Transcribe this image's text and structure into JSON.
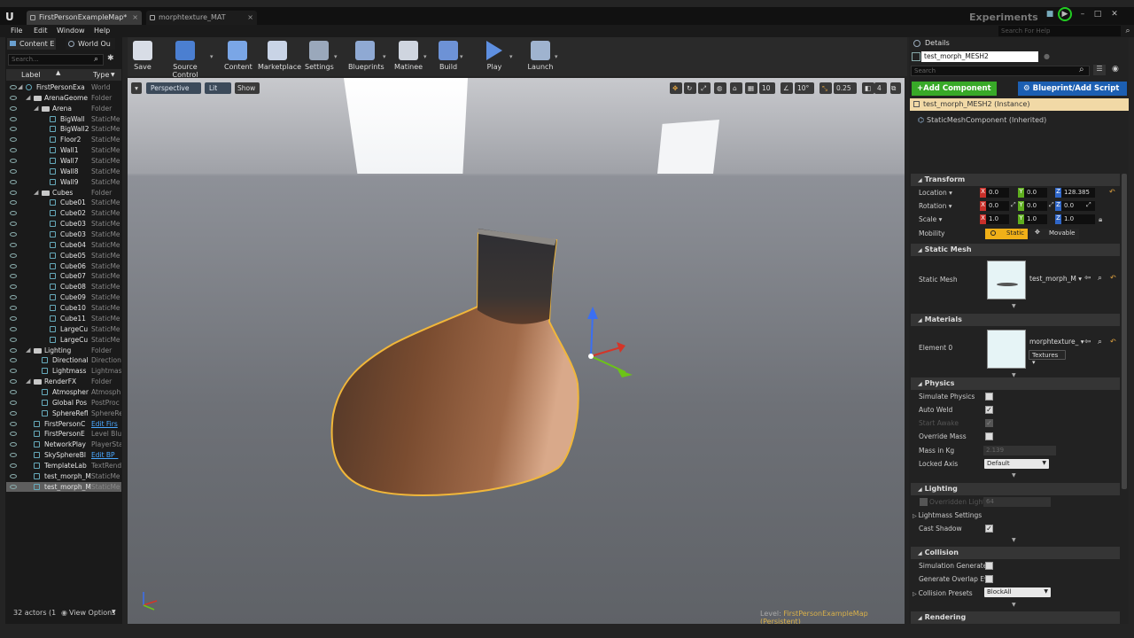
{
  "window": {
    "logo": "U",
    "tabs": [
      "FirstPersonExampleMap*",
      "morphtexture_MAT"
    ],
    "experiments": "Experiments",
    "help_search_placeholder": "Search For Help"
  },
  "menu": [
    "File",
    "Edit",
    "Window",
    "Help"
  ],
  "left_panel": {
    "tabs": [
      "Content E",
      "World Ou"
    ],
    "search_placeholder": "Search...",
    "col_label": "Label",
    "col_type": "Type",
    "rows": [
      {
        "label": "FirstPersonExa",
        "type": "World",
        "indent": 0,
        "kind": "world",
        "link": false,
        "selected": false
      },
      {
        "label": "ArenaGeome",
        "type": "Folder",
        "indent": 1,
        "kind": "folder",
        "link": false,
        "selected": false
      },
      {
        "label": "Arena",
        "type": "Folder",
        "indent": 2,
        "kind": "folder",
        "link": false,
        "selected": false
      },
      {
        "label": "BigWall",
        "type": "StaticMe",
        "indent": 3,
        "kind": "actor",
        "link": false,
        "selected": false
      },
      {
        "label": "BigWall2",
        "type": "StaticMe",
        "indent": 3,
        "kind": "actor",
        "link": false,
        "selected": false
      },
      {
        "label": "Floor2",
        "type": "StaticMe",
        "indent": 3,
        "kind": "actor",
        "link": false,
        "selected": false
      },
      {
        "label": "Wall1",
        "type": "StaticMe",
        "indent": 3,
        "kind": "actor",
        "link": false,
        "selected": false
      },
      {
        "label": "Wall7",
        "type": "StaticMe",
        "indent": 3,
        "kind": "actor",
        "link": false,
        "selected": false
      },
      {
        "label": "Wall8",
        "type": "StaticMe",
        "indent": 3,
        "kind": "actor",
        "link": false,
        "selected": false
      },
      {
        "label": "Wall9",
        "type": "StaticMe",
        "indent": 3,
        "kind": "actor",
        "link": false,
        "selected": false
      },
      {
        "label": "Cubes",
        "type": "Folder",
        "indent": 2,
        "kind": "folder",
        "link": false,
        "selected": false
      },
      {
        "label": "Cube01",
        "type": "StaticMe",
        "indent": 3,
        "kind": "actor",
        "link": false,
        "selected": false
      },
      {
        "label": "Cube02",
        "type": "StaticMe",
        "indent": 3,
        "kind": "actor",
        "link": false,
        "selected": false
      },
      {
        "label": "Cube03",
        "type": "StaticMe",
        "indent": 3,
        "kind": "actor",
        "link": false,
        "selected": false
      },
      {
        "label": "Cube03",
        "type": "StaticMe",
        "indent": 3,
        "kind": "actor",
        "link": false,
        "selected": false
      },
      {
        "label": "Cube04",
        "type": "StaticMe",
        "indent": 3,
        "kind": "actor",
        "link": false,
        "selected": false
      },
      {
        "label": "Cube05",
        "type": "StaticMe",
        "indent": 3,
        "kind": "actor",
        "link": false,
        "selected": false
      },
      {
        "label": "Cube06",
        "type": "StaticMe",
        "indent": 3,
        "kind": "actor",
        "link": false,
        "selected": false
      },
      {
        "label": "Cube07",
        "type": "StaticMe",
        "indent": 3,
        "kind": "actor",
        "link": false,
        "selected": false
      },
      {
        "label": "Cube08",
        "type": "StaticMe",
        "indent": 3,
        "kind": "actor",
        "link": false,
        "selected": false
      },
      {
        "label": "Cube09",
        "type": "StaticMe",
        "indent": 3,
        "kind": "actor",
        "link": false,
        "selected": false
      },
      {
        "label": "Cube10",
        "type": "StaticMe",
        "indent": 3,
        "kind": "actor",
        "link": false,
        "selected": false
      },
      {
        "label": "Cube11",
        "type": "StaticMe",
        "indent": 3,
        "kind": "actor",
        "link": false,
        "selected": false
      },
      {
        "label": "LargeCu",
        "type": "StaticMe",
        "indent": 3,
        "kind": "actor",
        "link": false,
        "selected": false
      },
      {
        "label": "LargeCu",
        "type": "StaticMe",
        "indent": 3,
        "kind": "actor",
        "link": false,
        "selected": false
      },
      {
        "label": "Lighting",
        "type": "Folder",
        "indent": 1,
        "kind": "folder",
        "link": false,
        "selected": false
      },
      {
        "label": "Directional",
        "type": "Direction",
        "indent": 2,
        "kind": "actor",
        "link": false,
        "selected": false
      },
      {
        "label": "Lightmass",
        "type": "Lightmas",
        "indent": 2,
        "kind": "actor",
        "link": false,
        "selected": false
      },
      {
        "label": "RenderFX",
        "type": "Folder",
        "indent": 1,
        "kind": "folder",
        "link": false,
        "selected": false
      },
      {
        "label": "Atmospher",
        "type": "Atmosph",
        "indent": 2,
        "kind": "actor",
        "link": false,
        "selected": false
      },
      {
        "label": "Global Pos",
        "type": "PostProc",
        "indent": 2,
        "kind": "actor",
        "link": false,
        "selected": false
      },
      {
        "label": "SphereRefl",
        "type": "SphereRe",
        "indent": 2,
        "kind": "actor",
        "link": false,
        "selected": false
      },
      {
        "label": "FirstPersonC",
        "type": "Edit Firs",
        "indent": 1,
        "kind": "actor",
        "link": true,
        "selected": false
      },
      {
        "label": "FirstPersonE",
        "type": "Level Blu",
        "indent": 1,
        "kind": "actor",
        "link": false,
        "selected": false
      },
      {
        "label": "NetworkPlay",
        "type": "PlayerSta",
        "indent": 1,
        "kind": "actor",
        "link": false,
        "selected": false
      },
      {
        "label": "SkySphereBl",
        "type": "Edit BP_",
        "indent": 1,
        "kind": "actor",
        "link": true,
        "selected": false
      },
      {
        "label": "TemplateLab",
        "type": "TextRend",
        "indent": 1,
        "kind": "actor",
        "link": false,
        "selected": false
      },
      {
        "label": "test_morph_M",
        "type": "StaticMe",
        "indent": 1,
        "kind": "actor",
        "link": false,
        "selected": false
      },
      {
        "label": "test_morph_M",
        "type": "StaticMe",
        "indent": 1,
        "kind": "actor",
        "link": false,
        "selected": true
      }
    ],
    "actor_count": "32 actors (1",
    "view_options": "View Options"
  },
  "toolbar": [
    {
      "label": "Save",
      "icon": "save-icon",
      "color": "#d8dde6",
      "drop": false
    },
    {
      "label": "Source Control",
      "icon": "source-control-icon",
      "color": "#4b7fd1",
      "drop": true
    },
    {
      "label": "Content",
      "icon": "content-icon",
      "color": "#7aa6e6",
      "drop": false
    },
    {
      "label": "Marketplace",
      "icon": "marketplace-icon",
      "color": "#c9d4e6",
      "drop": false
    },
    {
      "label": "Settings",
      "icon": "settings-icon",
      "color": "#9aa8bb",
      "drop": true
    },
    {
      "label": "Blueprints",
      "icon": "blueprints-icon",
      "color": "#8fa9d3",
      "drop": true
    },
    {
      "label": "Matinee",
      "icon": "matinee-icon",
      "color": "#cfd5df",
      "drop": true
    },
    {
      "label": "Build",
      "icon": "build-icon",
      "color": "#6d92d6",
      "drop": true
    },
    {
      "label": "Play",
      "icon": "play-icon",
      "color": "#5e8fe0",
      "drop": true
    },
    {
      "label": "Launch",
      "icon": "launch-icon",
      "color": "#9fb3cf",
      "drop": true
    }
  ],
  "viewport": {
    "perspective": "Perspective",
    "lit": "Lit",
    "show": "Show",
    "grid_snap": "10",
    "rot_snap": "10°",
    "scale_snap": "0.25",
    "cam_speed": "4",
    "level_label": "Level:",
    "level_name": "FirstPersonExampleMap (Persistent)"
  },
  "details": {
    "tab": "Details",
    "name": "test_morph_MESH2",
    "search_placeholder": "Search",
    "add_component": "+Add Component",
    "blueprint": "Blueprint/Add Script",
    "instance": "test_morph_MESH2 (Instance)",
    "component": "StaticMeshComponent (Inherited)",
    "transform": {
      "header": "Transform",
      "location_label": "Location",
      "rotation_label": "Rotation",
      "scale_label": "Scale",
      "mobility_label": "Mobility",
      "location": [
        "0.0",
        "0.0",
        "128.385"
      ],
      "rotation": [
        "0.0",
        "0.0",
        "0.0"
      ],
      "scale": [
        "1.0",
        "1.0",
        "1.0"
      ],
      "static": "Static",
      "movable": "Movable"
    },
    "static_mesh": {
      "header": "Static Mesh",
      "label": "Static Mesh",
      "value": "test_morph_M"
    },
    "materials": {
      "header": "Materials",
      "label": "Element 0",
      "value": "morphtexture_",
      "textures": "Textures"
    },
    "physics": {
      "header": "Physics",
      "simulate": "Simulate Physics",
      "auto_weld": "Auto Weld",
      "start_awake": "Start Awake",
      "override_mass": "Override Mass",
      "mass": "Mass in Kg",
      "mass_value": "2.139",
      "locked_axis": "Locked Axis",
      "locked_value": "Default"
    },
    "lighting": {
      "header": "Lighting",
      "overridden": "Overridden Light",
      "overridden_value": "64",
      "lightmass": "Lightmass Settings",
      "cast_shadow": "Cast Shadow"
    },
    "collision": {
      "header": "Collision",
      "sim_gen": "Simulation Generates",
      "gen_overlap": "Generate Overlap Eve",
      "presets": "Collision Presets",
      "presets_value": "BlockAll"
    },
    "rendering": {
      "header": "Rendering"
    }
  }
}
